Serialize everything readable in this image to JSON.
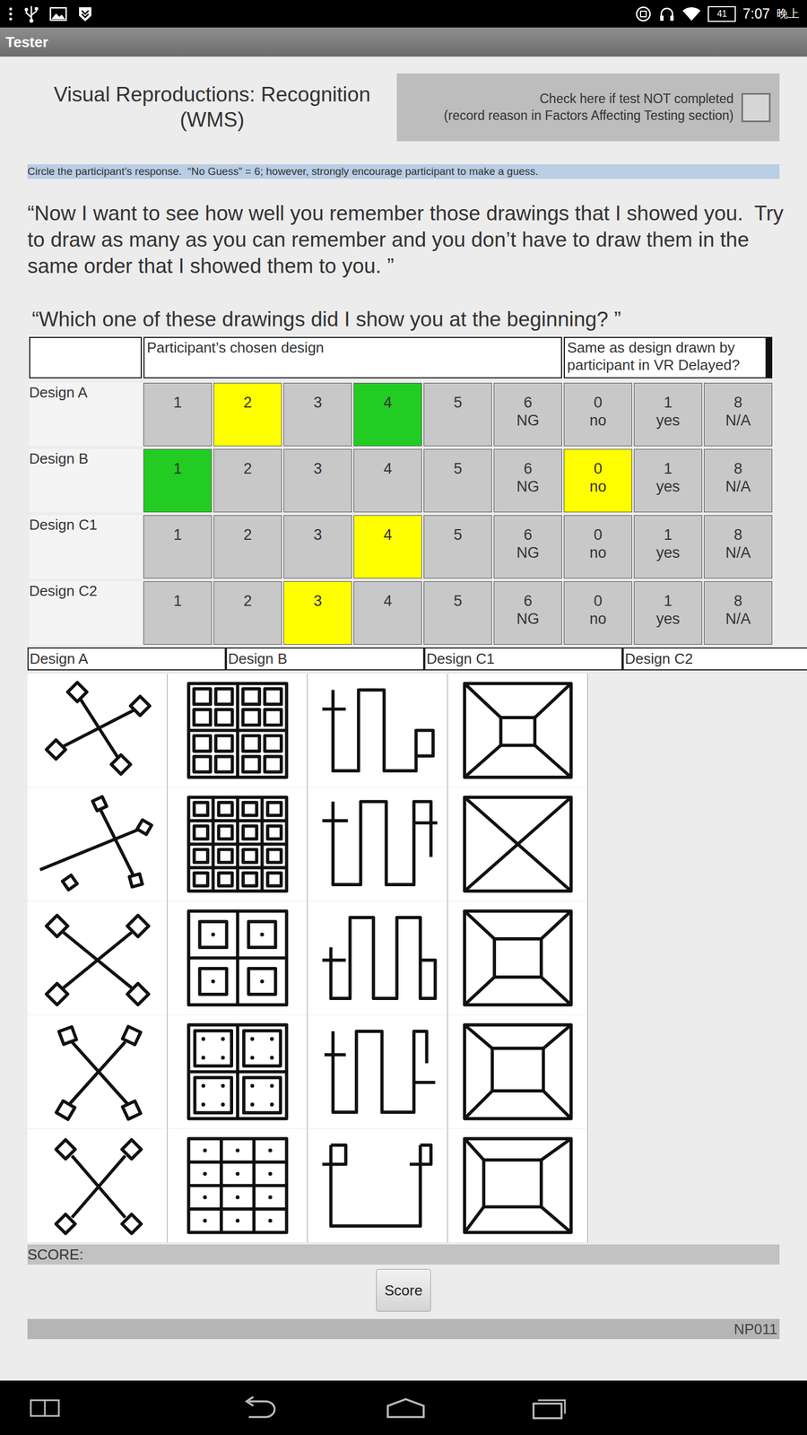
{
  "status_bar": {
    "battery": "41",
    "time": "7:07",
    "period": "晚上"
  },
  "app_bar": {
    "title": "Tester"
  },
  "header": {
    "title": "Visual Reproductions: Recognition (WMS)",
    "not_completed": {
      "line1": "Check here if test NOT completed",
      "line2": "(record reason in Factors Affecting Testing section)",
      "checked": false
    }
  },
  "instruction": "Circle the participant’s response.  “No Guess” = 6; however, strongly encourage participant to make a guess.",
  "prompts": [
    "“Now I want to see how well you remember those drawings that I showed you.  Try to draw as many as you can remember and you don’t have to draw them in the same order that I showed them to you. ”",
    "“Which one of these drawings did I show you at the beginning? ”"
  ],
  "table": {
    "columns": [
      "",
      "Participant’s chosen design",
      "Same as design drawn by participant in VR Delayed?"
    ],
    "rows": [
      {
        "label": "Design A",
        "cells": [
          {
            "top": "1",
            "bottom": "",
            "color": "#c8c8c8"
          },
          {
            "top": "2",
            "bottom": "",
            "color": "#ffff00"
          },
          {
            "top": "3",
            "bottom": "",
            "color": "#c8c8c8"
          },
          {
            "top": "4",
            "bottom": "",
            "color": "#22cc22"
          },
          {
            "top": "5",
            "bottom": "",
            "color": "#c8c8c8"
          },
          {
            "top": "6",
            "bottom": "NG",
            "color": "#c8c8c8"
          },
          {
            "top": "0",
            "bottom": "no",
            "color": "#c8c8c8"
          },
          {
            "top": "1",
            "bottom": "yes",
            "color": "#c8c8c8"
          },
          {
            "top": "8",
            "bottom": "N/A",
            "color": "#c8c8c8"
          }
        ]
      },
      {
        "label": "Design B",
        "cells": [
          {
            "top": "1",
            "bottom": "",
            "color": "#22cc22"
          },
          {
            "top": "2",
            "bottom": "",
            "color": "#c8c8c8"
          },
          {
            "top": "3",
            "bottom": "",
            "color": "#c8c8c8"
          },
          {
            "top": "4",
            "bottom": "",
            "color": "#c8c8c8"
          },
          {
            "top": "5",
            "bottom": "",
            "color": "#c8c8c8"
          },
          {
            "top": "6",
            "bottom": "NG",
            "color": "#c8c8c8"
          },
          {
            "top": "0",
            "bottom": "no",
            "color": "#ffff00"
          },
          {
            "top": "1",
            "bottom": "yes",
            "color": "#c8c8c8"
          },
          {
            "top": "8",
            "bottom": "N/A",
            "color": "#c8c8c8"
          }
        ]
      },
      {
        "label": "Design C1",
        "cells": [
          {
            "top": "1",
            "bottom": "",
            "color": "#c8c8c8"
          },
          {
            "top": "2",
            "bottom": "",
            "color": "#c8c8c8"
          },
          {
            "top": "3",
            "bottom": "",
            "color": "#c8c8c8"
          },
          {
            "top": "4",
            "bottom": "",
            "color": "#ffff00"
          },
          {
            "top": "5",
            "bottom": "",
            "color": "#c8c8c8"
          },
          {
            "top": "6",
            "bottom": "NG",
            "color": "#c8c8c8"
          },
          {
            "top": "0",
            "bottom": "no",
            "color": "#c8c8c8"
          },
          {
            "top": "1",
            "bottom": "yes",
            "color": "#c8c8c8"
          },
          {
            "top": "8",
            "bottom": "N/A",
            "color": "#c8c8c8"
          }
        ]
      },
      {
        "label": "Design C2",
        "cells": [
          {
            "top": "1",
            "bottom": "",
            "color": "#c8c8c8"
          },
          {
            "top": "2",
            "bottom": "",
            "color": "#c8c8c8"
          },
          {
            "top": "3",
            "bottom": "",
            "color": "#ffff00"
          },
          {
            "top": "4",
            "bottom": "",
            "color": "#c8c8c8"
          },
          {
            "top": "5",
            "bottom": "",
            "color": "#c8c8c8"
          },
          {
            "top": "6",
            "bottom": "NG",
            "color": "#c8c8c8"
          },
          {
            "top": "0",
            "bottom": "no",
            "color": "#c8c8c8"
          },
          {
            "top": "1",
            "bottom": "yes",
            "color": "#c8c8c8"
          },
          {
            "top": "8",
            "bottom": "N/A",
            "color": "#c8c8c8"
          }
        ]
      }
    ]
  },
  "drawings": [
    {
      "label": "Design A",
      "items": [
        {
          "kind": "a1"
        },
        {
          "kind": "a2"
        },
        {
          "kind": "a3"
        },
        {
          "kind": "a4"
        },
        {
          "kind": "a5"
        }
      ]
    },
    {
      "label": "Design B",
      "items": [
        {
          "kind": "b1"
        },
        {
          "kind": "b2"
        },
        {
          "kind": "b3"
        },
        {
          "kind": "b4"
        },
        {
          "kind": "b5"
        }
      ]
    },
    {
      "label": "Design C1",
      "items": [
        {
          "kind": "c1"
        },
        {
          "kind": "c2"
        },
        {
          "kind": "c3"
        },
        {
          "kind": "c4"
        },
        {
          "kind": "c5"
        }
      ]
    },
    {
      "label": "Design C2",
      "items": [
        {
          "kind": "d1"
        },
        {
          "kind": "d2"
        },
        {
          "kind": "d3"
        },
        {
          "kind": "d4"
        },
        {
          "kind": "d5"
        }
      ]
    }
  ],
  "score": {
    "label": "SCORE:"
  },
  "score_button": "Score",
  "footer": {
    "code": "NP011"
  }
}
